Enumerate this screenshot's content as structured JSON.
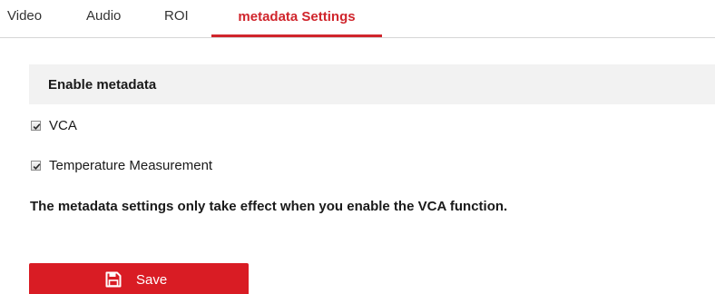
{
  "tabs": [
    {
      "label": "Video",
      "active": false
    },
    {
      "label": "Audio",
      "active": false
    },
    {
      "label": "ROI",
      "active": false
    },
    {
      "label": "metadata Settings",
      "active": true
    }
  ],
  "section": {
    "title": "Enable metadata"
  },
  "options": [
    {
      "label": "VCA",
      "checked": true
    },
    {
      "label": "Temperature Measurement",
      "checked": true
    }
  ],
  "note": "The metadata settings only take effect when you enable the VCA function.",
  "save_button": {
    "label": "Save",
    "icon": "save-icon"
  },
  "colors": {
    "accent": "#d0252c",
    "button": "#d91c24",
    "section_bg": "#f2f2f2"
  }
}
